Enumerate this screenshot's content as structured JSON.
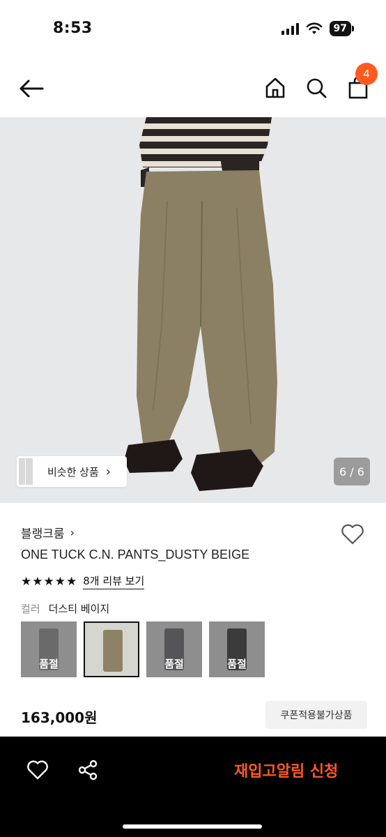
{
  "status_bar": {
    "time": "8:53",
    "battery": "97"
  },
  "nav": {
    "cart_count": "4"
  },
  "gallery": {
    "similar_label": "비슷한 상품",
    "page_counter": "6 / 6"
  },
  "product": {
    "brand": "블랭크룸",
    "name": "ONE TUCK C.N. PANTS_DUSTY BEIGE",
    "stars": "★★★★★",
    "rating": 5,
    "review_link": "8개 리뷰 보기",
    "color_label": "컬러",
    "color_value": "더스티 베이지",
    "swatches": [
      {
        "soldout": "품절",
        "color": "#6a6a6a"
      },
      {
        "soldout": "",
        "color": "#8e8265"
      },
      {
        "soldout": "품절",
        "color": "#555558"
      },
      {
        "soldout": "품절",
        "color": "#3b3b3b"
      }
    ],
    "price": "163,000원",
    "coupon": "쿠폰적용불가상품"
  },
  "bottom_bar": {
    "restock_label": "재입고알림 신청"
  },
  "colors": {
    "accent": "#ff5a1f",
    "pants": "#8b8064",
    "sweater_dark": "#2a2522",
    "sweater_light": "#e6e0d5"
  },
  "icons": [
    "back-arrow-icon",
    "home-icon",
    "search-icon",
    "cart-icon",
    "heart-icon",
    "share-icon",
    "chevron-right-icon"
  ]
}
